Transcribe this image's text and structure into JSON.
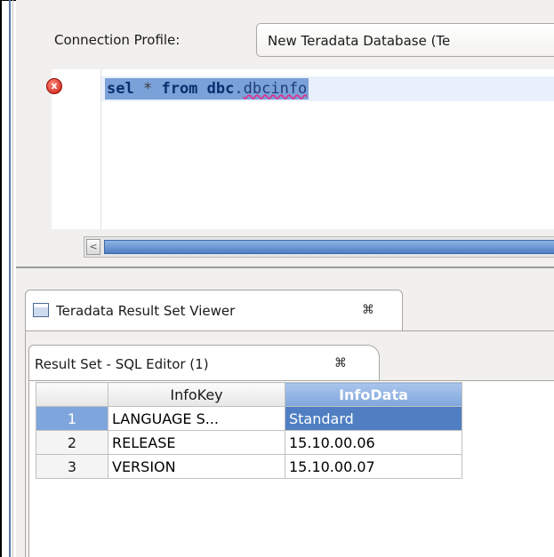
{
  "connection": {
    "label": "Connection Profile:",
    "value": "New Teradata Database (Te"
  },
  "editor": {
    "code_tokens": {
      "kw_sel": "sel",
      "star": "*",
      "kw_from": "from",
      "kw_dbc": "dbc",
      "dot": ".",
      "table": "dbcinfo"
    },
    "error_marker": "x"
  },
  "scrollbar": {
    "left_arrow": "<"
  },
  "result_viewer": {
    "tab_label": "Teradata Result Set Viewer",
    "close_glyph": "⌘"
  },
  "result_set": {
    "tab_label": "Result Set - SQL Editor (1)",
    "close_glyph": "⌘",
    "columns": [
      "",
      "InfoKey",
      "InfoData"
    ],
    "rows": [
      {
        "num": "1",
        "key": "LANGUAGE S...",
        "data": "Standard"
      },
      {
        "num": "2",
        "key": "RELEASE",
        "data": "15.10.00.06"
      },
      {
        "num": "3",
        "key": "VERSION",
        "data": "15.10.00.07"
      }
    ]
  },
  "colors": {
    "selection": "#7aa1d8",
    "selected_cell": "#4f7fc2",
    "error": "#c8180f"
  }
}
